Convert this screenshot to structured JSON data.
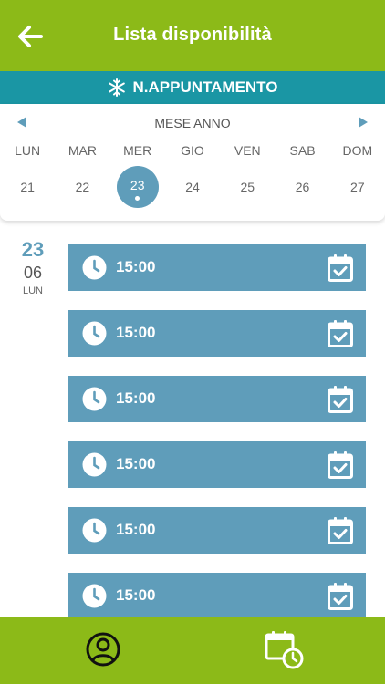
{
  "header": {
    "title": "Lista disponibilità",
    "back_icon": "arrow-left-icon"
  },
  "banner": {
    "label": "N.APPUNTAMENTO",
    "icon": "snowflake-icon"
  },
  "calendar": {
    "month_label": "MESE ANNO",
    "weekdays": [
      "LUN",
      "MAR",
      "MER",
      "GIO",
      "VEN",
      "SAB",
      "DOM"
    ],
    "dates": [
      "21",
      "22",
      "23",
      "24",
      "25",
      "26",
      "27"
    ],
    "selected_date": "23"
  },
  "selected_day": {
    "day": "23",
    "month": "06",
    "weekday": "LUN"
  },
  "slots": [
    {
      "time": "15:00"
    },
    {
      "time": "15:00"
    },
    {
      "time": "15:00"
    },
    {
      "time": "15:00"
    },
    {
      "time": "15:00"
    },
    {
      "time": "15:00"
    }
  ],
  "bottom_nav": {
    "items": [
      "profile-icon",
      "calendar-clock-icon"
    ]
  },
  "colors": {
    "green": "#8cba18",
    "teal": "#1a96a4",
    "blue": "#5f9dba"
  }
}
